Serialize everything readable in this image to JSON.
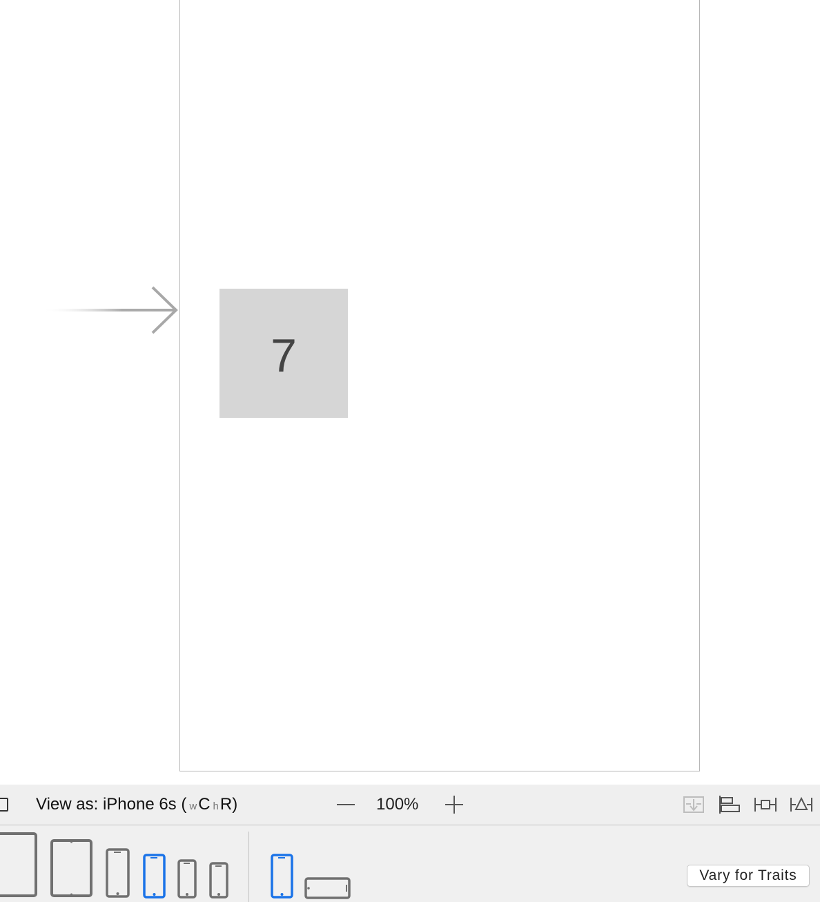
{
  "scene": {
    "tile_label": "7"
  },
  "toolbar": {
    "view_as_prefix": "View as: iPhone 6s (",
    "width_class_prefix": "w",
    "width_class": "C",
    "height_class_prefix": "h",
    "height_class": "R",
    "view_as_suffix": ")",
    "zoom_level": "100%"
  },
  "devices": [
    {
      "icon": "ipad-pro-icon",
      "selected": false
    },
    {
      "icon": "ipad-icon",
      "selected": false
    },
    {
      "icon": "iphone-6s-plus-icon",
      "selected": false
    },
    {
      "icon": "iphone-6s-icon",
      "selected": true
    },
    {
      "icon": "iphone-se-icon",
      "selected": false
    },
    {
      "icon": "iphone-4s-icon",
      "selected": false
    }
  ],
  "orientations": [
    {
      "icon": "portrait-icon",
      "selected": true
    },
    {
      "icon": "landscape-icon",
      "selected": false
    }
  ],
  "vary_button_label": "Vary for Traits",
  "colors": {
    "selected": "#1a73e8",
    "unselected": "#707070",
    "tile": "#d6d6d6"
  }
}
